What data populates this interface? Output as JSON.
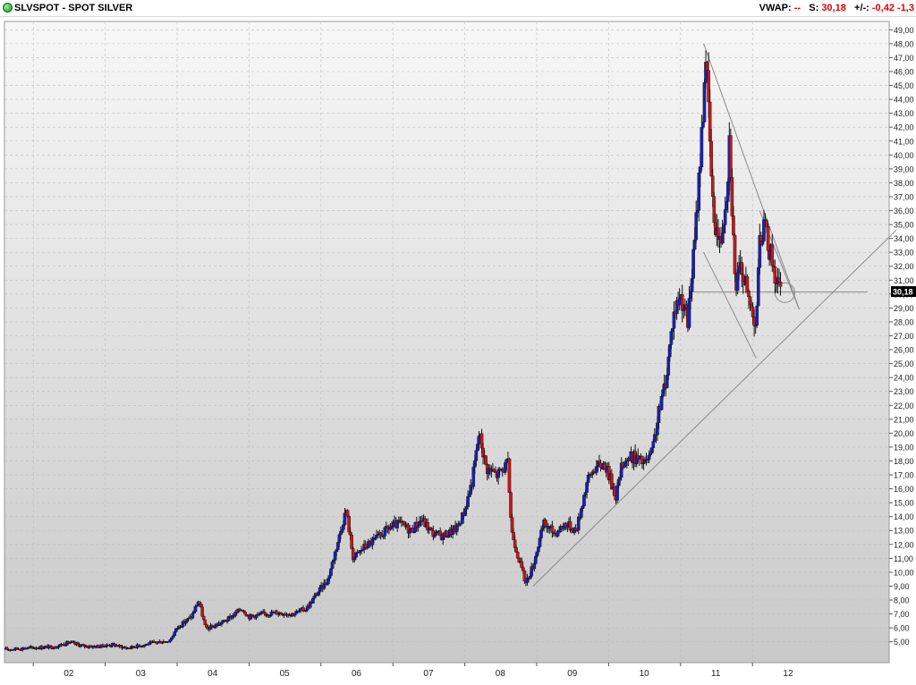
{
  "header": {
    "symbol_title": "SLVSPOT - SPOT SILVER",
    "vwap_label": "VWAP:",
    "vwap_value": "--",
    "spot_label": "S:",
    "spot_value": "30,18",
    "change_label": "+/-:",
    "change_value": "-0,42",
    "change_pct": "-1,3"
  },
  "colors": {
    "up": "#1a22b0",
    "down": "#c41a1a",
    "trendline": "#8a8a8a",
    "background_top": "#f7f7f7",
    "background_bottom": "#c9c9c9"
  },
  "chart_data": {
    "type": "candlestick",
    "x_ticks": [
      "02",
      "03",
      "04",
      "05",
      "06",
      "07",
      "08",
      "09",
      "10",
      "11",
      "12"
    ],
    "x_range": [
      2001.6,
      2013.9
    ],
    "y_range": [
      3.5,
      49.6
    ],
    "y_ticks": [
      "5,00",
      "6,00",
      "7,00",
      "8,00",
      "9,00",
      "10,00",
      "11,00",
      "12,00",
      "13,00",
      "14,00",
      "15,00",
      "16,00",
      "17,00",
      "18,00",
      "19,00",
      "20,00",
      "21,00",
      "22,00",
      "23,00",
      "24,00",
      "25,00",
      "26,00",
      "27,00",
      "28,00",
      "29,00",
      "30,00",
      "31,00",
      "32,00",
      "33,00",
      "34,00",
      "35,00",
      "36,00",
      "37,00",
      "38,00",
      "39,00",
      "40,00",
      "41,00",
      "42,00",
      "43,00",
      "44,00",
      "45,00",
      "46,00",
      "47,00",
      "48,00",
      "49,00"
    ],
    "last_price_label": "30,18",
    "last_price": 30.18,
    "grid": true,
    "price_path": [
      [
        2001.62,
        4.45
      ],
      [
        2001.9,
        4.55
      ],
      [
        2002.1,
        4.6
      ],
      [
        2002.3,
        4.65
      ],
      [
        2002.5,
        4.95
      ],
      [
        2002.7,
        4.7
      ],
      [
        2002.9,
        4.65
      ],
      [
        2003.1,
        4.8
      ],
      [
        2003.3,
        4.55
      ],
      [
        2003.5,
        4.75
      ],
      [
        2003.7,
        4.95
      ],
      [
        2003.9,
        5.1
      ],
      [
        2004.0,
        6.0
      ],
      [
        2004.2,
        6.8
      ],
      [
        2004.3,
        8.0
      ],
      [
        2004.4,
        5.9
      ],
      [
        2004.55,
        6.2
      ],
      [
        2004.7,
        6.6
      ],
      [
        2004.9,
        7.4
      ],
      [
        2005.0,
        6.8
      ],
      [
        2005.2,
        7.0
      ],
      [
        2005.4,
        7.1
      ],
      [
        2005.6,
        7.0
      ],
      [
        2005.8,
        7.4
      ],
      [
        2005.95,
        8.5
      ],
      [
        2006.1,
        9.5
      ],
      [
        2006.25,
        12.5
      ],
      [
        2006.35,
        14.5
      ],
      [
        2006.45,
        11.0
      ],
      [
        2006.6,
        11.8
      ],
      [
        2006.8,
        12.5
      ],
      [
        2006.95,
        13.2
      ],
      [
        2007.1,
        13.5
      ],
      [
        2007.25,
        13.0
      ],
      [
        2007.4,
        13.8
      ],
      [
        2007.55,
        12.8
      ],
      [
        2007.7,
        12.6
      ],
      [
        2007.9,
        13.2
      ],
      [
        2008.0,
        14.5
      ],
      [
        2008.1,
        16.5
      ],
      [
        2008.2,
        20.0
      ],
      [
        2008.3,
        17.5
      ],
      [
        2008.45,
        17.0
      ],
      [
        2008.6,
        17.8
      ],
      [
        2008.65,
        13.0
      ],
      [
        2008.75,
        11.0
      ],
      [
        2008.85,
        9.2
      ],
      [
        2008.95,
        10.5
      ],
      [
        2009.1,
        13.5
      ],
      [
        2009.25,
        12.8
      ],
      [
        2009.4,
        13.5
      ],
      [
        2009.55,
        13.0
      ],
      [
        2009.7,
        16.5
      ],
      [
        2009.8,
        17.5
      ],
      [
        2009.95,
        17.8
      ],
      [
        2010.1,
        15.5
      ],
      [
        2010.2,
        18.0
      ],
      [
        2010.35,
        18.3
      ],
      [
        2010.5,
        17.8
      ],
      [
        2010.6,
        18.5
      ],
      [
        2010.7,
        21.5
      ],
      [
        2010.8,
        24.0
      ],
      [
        2010.9,
        28.5
      ],
      [
        2011.0,
        30.0
      ],
      [
        2011.1,
        28.0
      ],
      [
        2011.2,
        34.0
      ],
      [
        2011.3,
        42.0
      ],
      [
        2011.35,
        47.5
      ],
      [
        2011.45,
        36.0
      ],
      [
        2011.55,
        33.5
      ],
      [
        2011.65,
        38.0
      ],
      [
        2011.68,
        41.5
      ],
      [
        2011.72,
        36.0
      ],
      [
        2011.76,
        30.5
      ],
      [
        2011.85,
        32.0
      ],
      [
        2011.95,
        29.5
      ],
      [
        2012.05,
        28.0
      ],
      [
        2012.1,
        33.5
      ],
      [
        2012.15,
        35.0
      ],
      [
        2012.25,
        33.0
      ],
      [
        2012.33,
        31.0
      ],
      [
        2012.4,
        30.18
      ]
    ],
    "trendlines": [
      {
        "points": [
          [
            2008.95,
            9.0
          ],
          [
            2014.0,
            34.6
          ]
        ]
      },
      {
        "points": [
          [
            2011.32,
            48.0
          ],
          [
            2012.65,
            28.9
          ]
        ]
      },
      {
        "points": [
          [
            2011.32,
            33.0
          ],
          [
            2012.05,
            25.4
          ]
        ]
      },
      {
        "points": [
          [
            2012.1,
            36.0
          ],
          [
            2012.65,
            28.9
          ]
        ]
      },
      {
        "points": [
          [
            2011.15,
            30.15
          ],
          [
            2013.6,
            30.15
          ]
        ]
      }
    ],
    "annotation_circle": {
      "x": 2012.45,
      "y": 30.1
    }
  }
}
